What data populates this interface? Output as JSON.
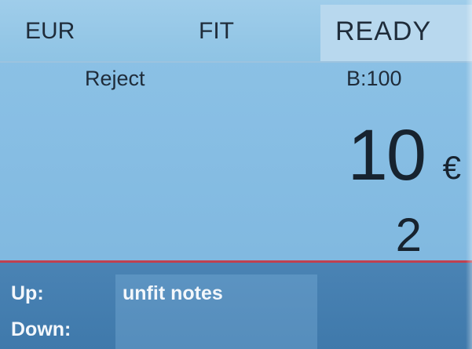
{
  "status_bar": {
    "currency": "EUR",
    "mode": "FIT",
    "state": "READY"
  },
  "main": {
    "reject_label": "Reject",
    "batch": "B:100",
    "denomination": "10",
    "currency_symbol": "€",
    "count": "2"
  },
  "soft_keys": {
    "up_label": "Up:",
    "up_value": "unfit notes",
    "down_label": "Down:",
    "down_value": ""
  }
}
